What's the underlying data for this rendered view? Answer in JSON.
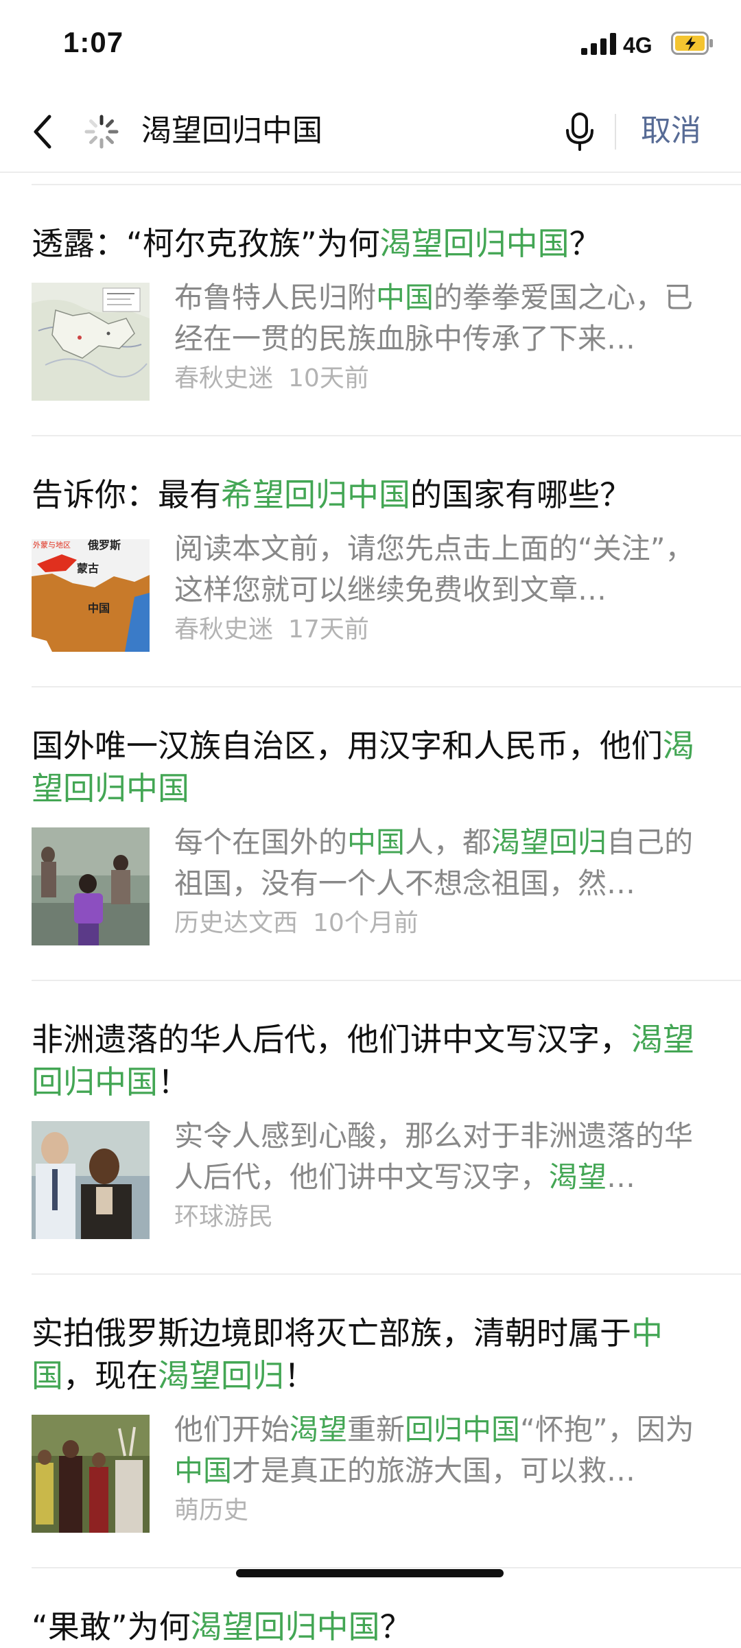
{
  "status_bar": {
    "time": "1:07",
    "network": "4G",
    "signal_icon": "cellular-signal-icon",
    "battery_icon": "battery-charging-icon"
  },
  "search": {
    "query": "渴望回归中国",
    "cancel_label": "取消",
    "back_icon": "chevron-left-icon",
    "loading_icon": "spinner-icon",
    "mic_icon": "microphone-icon"
  },
  "colors": {
    "highlight": "#43a654",
    "cancel": "#576b95",
    "snippet": "#888888",
    "meta": "#b3b3b3"
  },
  "results": [
    {
      "title": [
        {
          "text": "透露：“柯尔克孜族”为何",
          "hl": false
        },
        {
          "text": "渴望回归中国",
          "hl": true
        },
        {
          "text": "？",
          "hl": false
        }
      ],
      "snippet": [
        {
          "text": "布鲁特人民归附",
          "hl": false
        },
        {
          "text": "中国",
          "hl": true
        },
        {
          "text": "的拳拳爱国之心，已经在一贯的民族血脉中传承了下来…",
          "hl": false
        }
      ],
      "source": "春秋史迷",
      "time": "10天前",
      "thumb": "map-thumbnail"
    },
    {
      "title": [
        {
          "text": "告诉你：最有",
          "hl": false
        },
        {
          "text": "希望回归中国",
          "hl": true
        },
        {
          "text": "的国家有哪些？",
          "hl": false
        }
      ],
      "snippet": [
        {
          "text": "阅读本文前，请您先点击上面的“关注”，这样您就可以继续免费收到文章…",
          "hl": false
        }
      ],
      "source": "春秋史迷",
      "time": "17天前",
      "thumb": "map-thumbnail",
      "thumb_labels": [
        "俄罗斯",
        "蒙古",
        "中国",
        "外蒙与地区"
      ]
    },
    {
      "title": [
        {
          "text": "国外唯一汉族自治区，用汉字和人民币，他们",
          "hl": false
        },
        {
          "text": "渴望回归中国",
          "hl": true
        }
      ],
      "snippet": [
        {
          "text": "每个在国外的",
          "hl": false
        },
        {
          "text": "中国",
          "hl": true
        },
        {
          "text": "人，都",
          "hl": false
        },
        {
          "text": "渴望回归",
          "hl": true
        },
        {
          "text": "自己的祖国，没有一个人不想念祖国，然…",
          "hl": false
        }
      ],
      "source": "历史达文西",
      "time": "10个月前",
      "thumb": "photo-thumbnail"
    },
    {
      "title": [
        {
          "text": "非洲遗落的华人后代，他们讲中文写汉字，",
          "hl": false
        },
        {
          "text": "渴望回归中国",
          "hl": true
        },
        {
          "text": "！",
          "hl": false
        }
      ],
      "snippet": [
        {
          "text": "实令人感到心酸，那么对于非洲遗落的华人后代，他们讲中文写汉字，",
          "hl": false
        },
        {
          "text": "渴望",
          "hl": true
        },
        {
          "text": "…",
          "hl": false
        }
      ],
      "source": "环球游民",
      "time": "",
      "thumb": "photo-thumbnail"
    },
    {
      "title": [
        {
          "text": "实拍俄罗斯边境即将灭亡部族，清朝时属于",
          "hl": false
        },
        {
          "text": "中国",
          "hl": true
        },
        {
          "text": "，现在",
          "hl": false
        },
        {
          "text": "渴望回归",
          "hl": true
        },
        {
          "text": "！",
          "hl": false
        }
      ],
      "snippet": [
        {
          "text": "他们开始",
          "hl": false
        },
        {
          "text": "渴望",
          "hl": true
        },
        {
          "text": "重新",
          "hl": false
        },
        {
          "text": "回归中国",
          "hl": true
        },
        {
          "text": "“怀抱”，因为",
          "hl": false
        },
        {
          "text": "中国",
          "hl": true
        },
        {
          "text": "才是真正的旅游大国，可以救…",
          "hl": false
        }
      ],
      "source": "萌历史",
      "time": "",
      "thumb": "photo-thumbnail"
    },
    {
      "title": [
        {
          "text": "“果敢”为何",
          "hl": false
        },
        {
          "text": "渴望回归中国",
          "hl": true
        },
        {
          "text": "？",
          "hl": false
        }
      ],
      "snippet": [],
      "source": "",
      "time": "",
      "thumb": ""
    }
  ]
}
